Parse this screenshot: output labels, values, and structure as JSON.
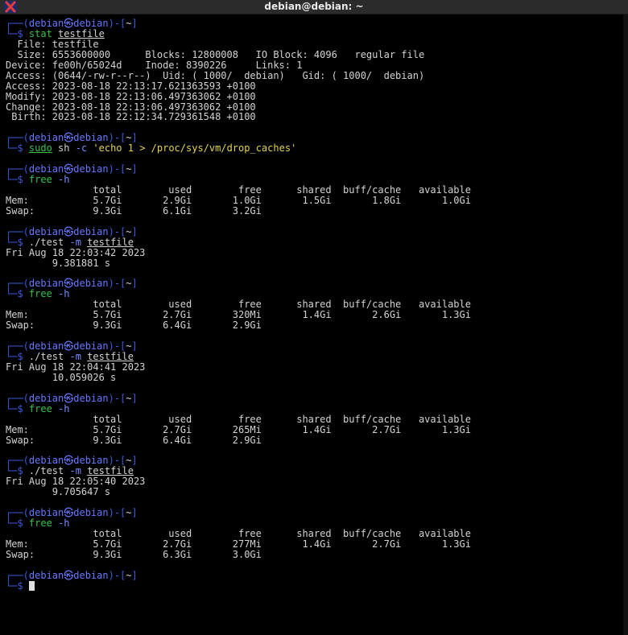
{
  "window": {
    "title": "debian@debian: ~",
    "icon": "x-terminal-icon"
  },
  "prompt": {
    "top": "┌──(debian㉿debian)-[~]",
    "arrow": "└─$ "
  },
  "blocks": [
    {
      "cmd": [
        {
          "t": "stat",
          "c": "cmd"
        },
        {
          "t": " "
        },
        {
          "t": "testfile",
          "c": "arg ul"
        }
      ],
      "out": [
        "  File: testfile",
        "  Size: 6553600000      Blocks: 12800008   IO Block: 4096   regular file",
        "Device: fe00h/65024d    Inode: 8390226     Links: 1",
        "Access: (0644/-rw-r--r--)  Uid: ( 1000/  debian)   Gid: ( 1000/  debian)",
        "Access: 2023-08-18 22:13:17.621363593 +0100",
        "Modify: 2023-08-18 22:13:06.497363062 +0100",
        "Change: 2023-08-18 22:13:06.497363062 +0100",
        " Birth: 2023-08-18 22:12:34.729361548 +0100",
        ""
      ]
    },
    {
      "cmd": [
        {
          "t": "sudo",
          "c": "cmd ul"
        },
        {
          "t": " sh ",
          "c": "arg"
        },
        {
          "t": "-c",
          "c": "opt"
        },
        {
          "t": " "
        },
        {
          "t": "'echo 1 > /proc/sys/vm/drop_caches'",
          "c": "str"
        }
      ],
      "out": [
        ""
      ]
    },
    {
      "cmd": [
        {
          "t": "free",
          "c": "cmd"
        },
        {
          "t": " "
        },
        {
          "t": "-h",
          "c": "opt"
        }
      ],
      "out": [
        "               total        used        free      shared  buff/cache   available",
        "Mem:           5.7Gi       2.9Gi       1.0Gi       1.5Gi       1.8Gi       1.0Gi",
        "Swap:          9.3Gi       6.1Gi       3.2Gi",
        ""
      ]
    },
    {
      "cmd": [
        {
          "t": "./test",
          "c": "arg"
        },
        {
          "t": " "
        },
        {
          "t": "-m",
          "c": "opt"
        },
        {
          "t": " "
        },
        {
          "t": "testfile",
          "c": "arg ul"
        }
      ],
      "out": [
        "Fri Aug 18 22:03:42 2023",
        "        9.381881 s",
        ""
      ]
    },
    {
      "cmd": [
        {
          "t": "free",
          "c": "cmd"
        },
        {
          "t": " "
        },
        {
          "t": "-h",
          "c": "opt"
        }
      ],
      "out": [
        "               total        used        free      shared  buff/cache   available",
        "Mem:           5.7Gi       2.7Gi       320Mi       1.4Gi       2.6Gi       1.3Gi",
        "Swap:          9.3Gi       6.4Gi       2.9Gi",
        ""
      ]
    },
    {
      "cmd": [
        {
          "t": "./test",
          "c": "arg"
        },
        {
          "t": " "
        },
        {
          "t": "-m",
          "c": "opt"
        },
        {
          "t": " "
        },
        {
          "t": "testfile",
          "c": "arg ul"
        }
      ],
      "out": [
        "Fri Aug 18 22:04:41 2023",
        "        10.059026 s",
        ""
      ]
    },
    {
      "cmd": [
        {
          "t": "free",
          "c": "cmd"
        },
        {
          "t": " "
        },
        {
          "t": "-h",
          "c": "opt"
        }
      ],
      "out": [
        "               total        used        free      shared  buff/cache   available",
        "Mem:           5.7Gi       2.7Gi       265Mi       1.4Gi       2.7Gi       1.3Gi",
        "Swap:          9.3Gi       6.4Gi       2.9Gi",
        ""
      ]
    },
    {
      "cmd": [
        {
          "t": "./test",
          "c": "arg"
        },
        {
          "t": " "
        },
        {
          "t": "-m",
          "c": "opt"
        },
        {
          "t": " "
        },
        {
          "t": "testfile",
          "c": "arg ul"
        }
      ],
      "out": [
        "Fri Aug 18 22:05:40 2023",
        "        9.705647 s",
        ""
      ]
    },
    {
      "cmd": [
        {
          "t": "free",
          "c": "cmd"
        },
        {
          "t": " "
        },
        {
          "t": "-h",
          "c": "opt"
        }
      ],
      "out": [
        "               total        used        free      shared  buff/cache   available",
        "Mem:           5.7Gi       2.7Gi       277Mi       1.4Gi       2.7Gi       1.3Gi",
        "Swap:          9.3Gi       6.3Gi       3.0Gi",
        ""
      ]
    },
    {
      "cmd": [],
      "cursor": true,
      "out": []
    }
  ],
  "colors": {
    "background": "#000000",
    "text": "#d3d3d3",
    "prompt": "#3b5bdb",
    "command": "#36c24a",
    "option": "#7a8cff",
    "string": "#e3d34f"
  }
}
